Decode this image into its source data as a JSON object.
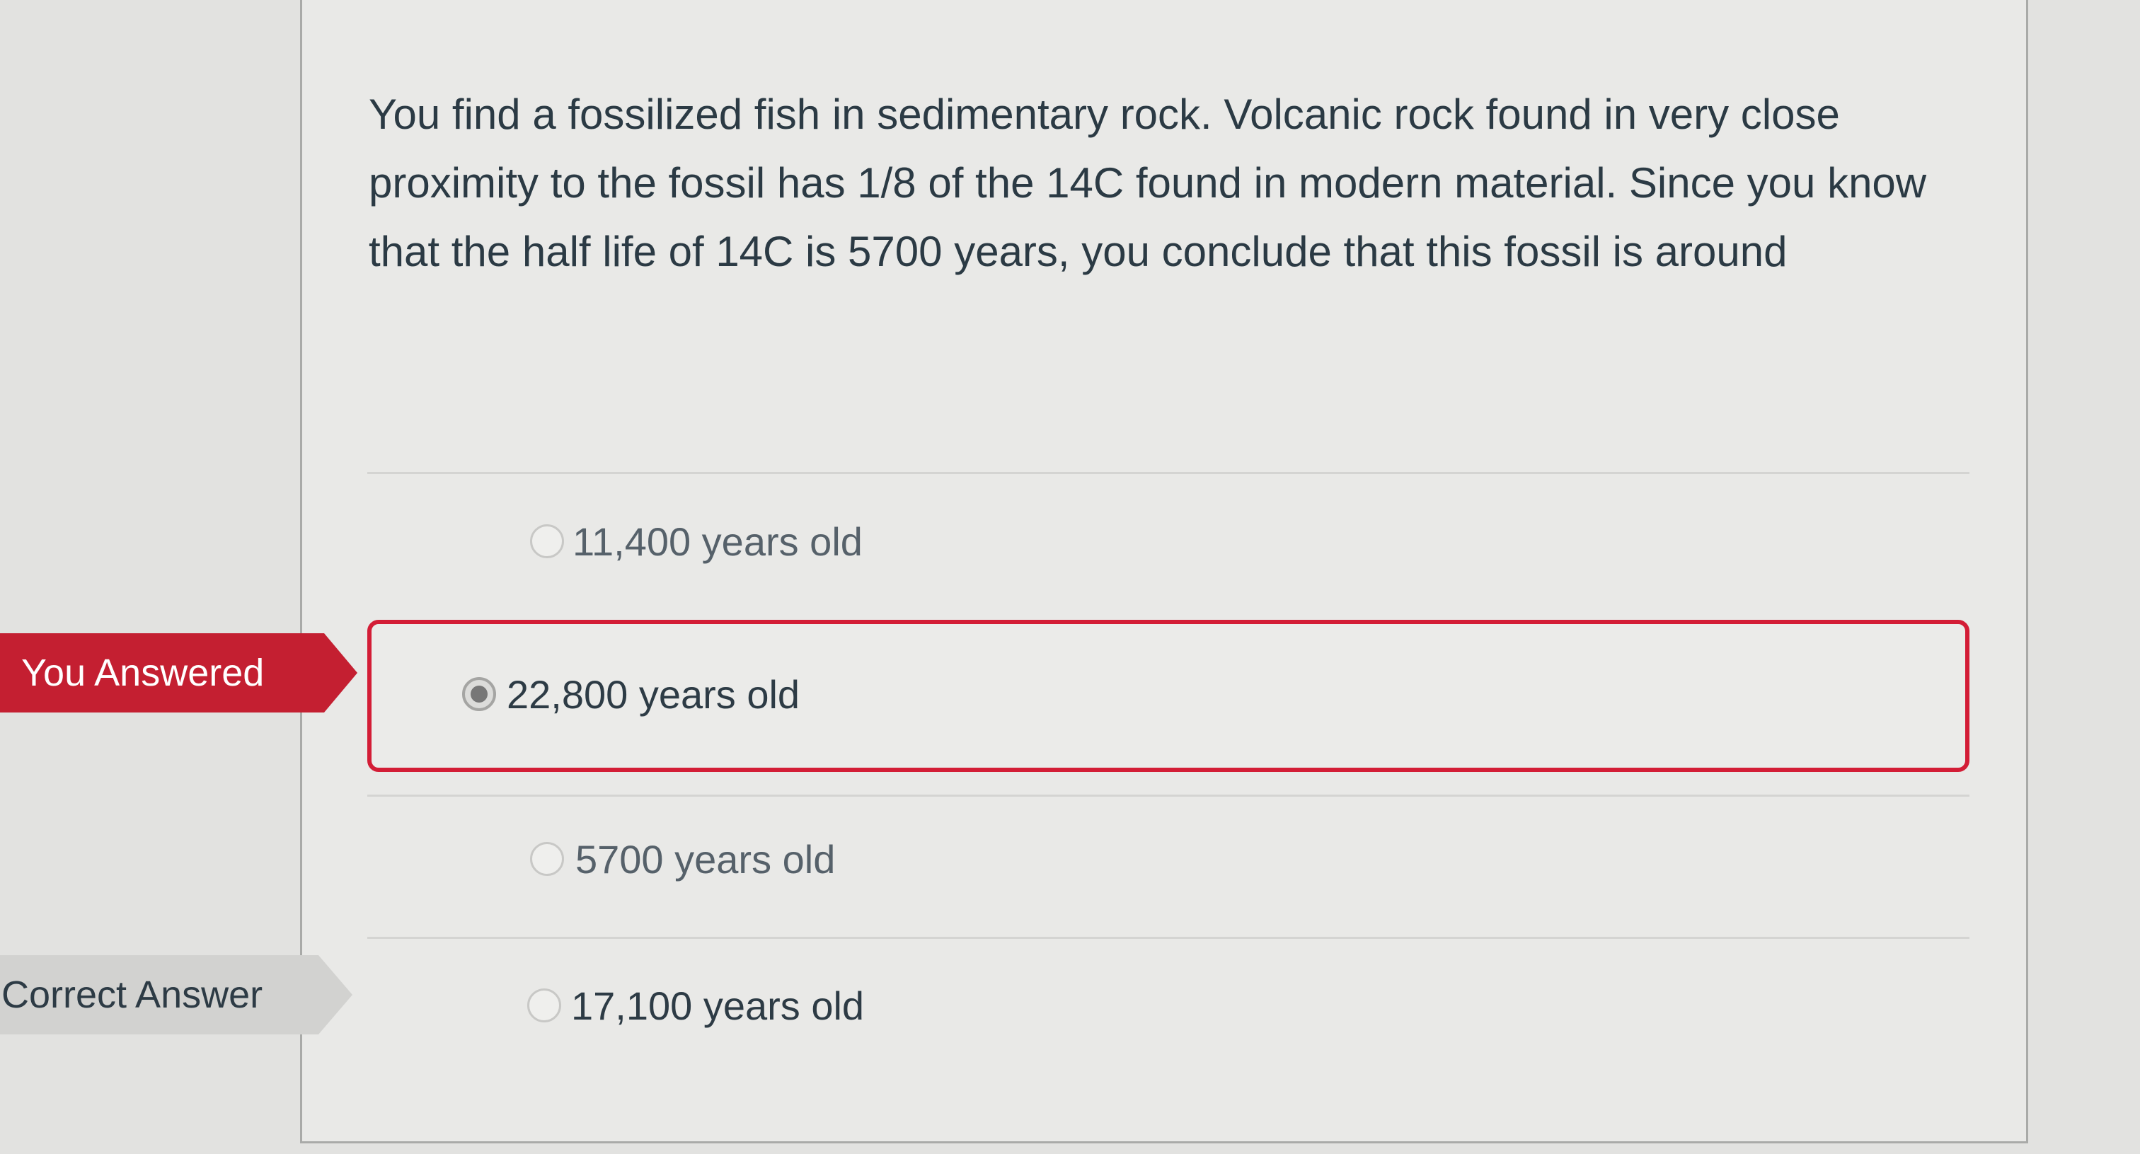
{
  "question": {
    "text": "You find a fossilized fish in sedimentary rock. Volcanic rock found in very close proximity to the fossil has 1/8 of the 14C found in modern material. Since you know that the half life of 14C is 5700 years, you conclude that this fossil is around"
  },
  "markers": {
    "you_answered": "You Answered",
    "correct_answer": "Correct Answer"
  },
  "answers": [
    {
      "label": "11,400 years old",
      "selected": false
    },
    {
      "label": "22,800 years old",
      "selected": true
    },
    {
      "label": "5700 years old",
      "selected": false
    },
    {
      "label": "17,100 years old",
      "selected": false
    }
  ]
}
